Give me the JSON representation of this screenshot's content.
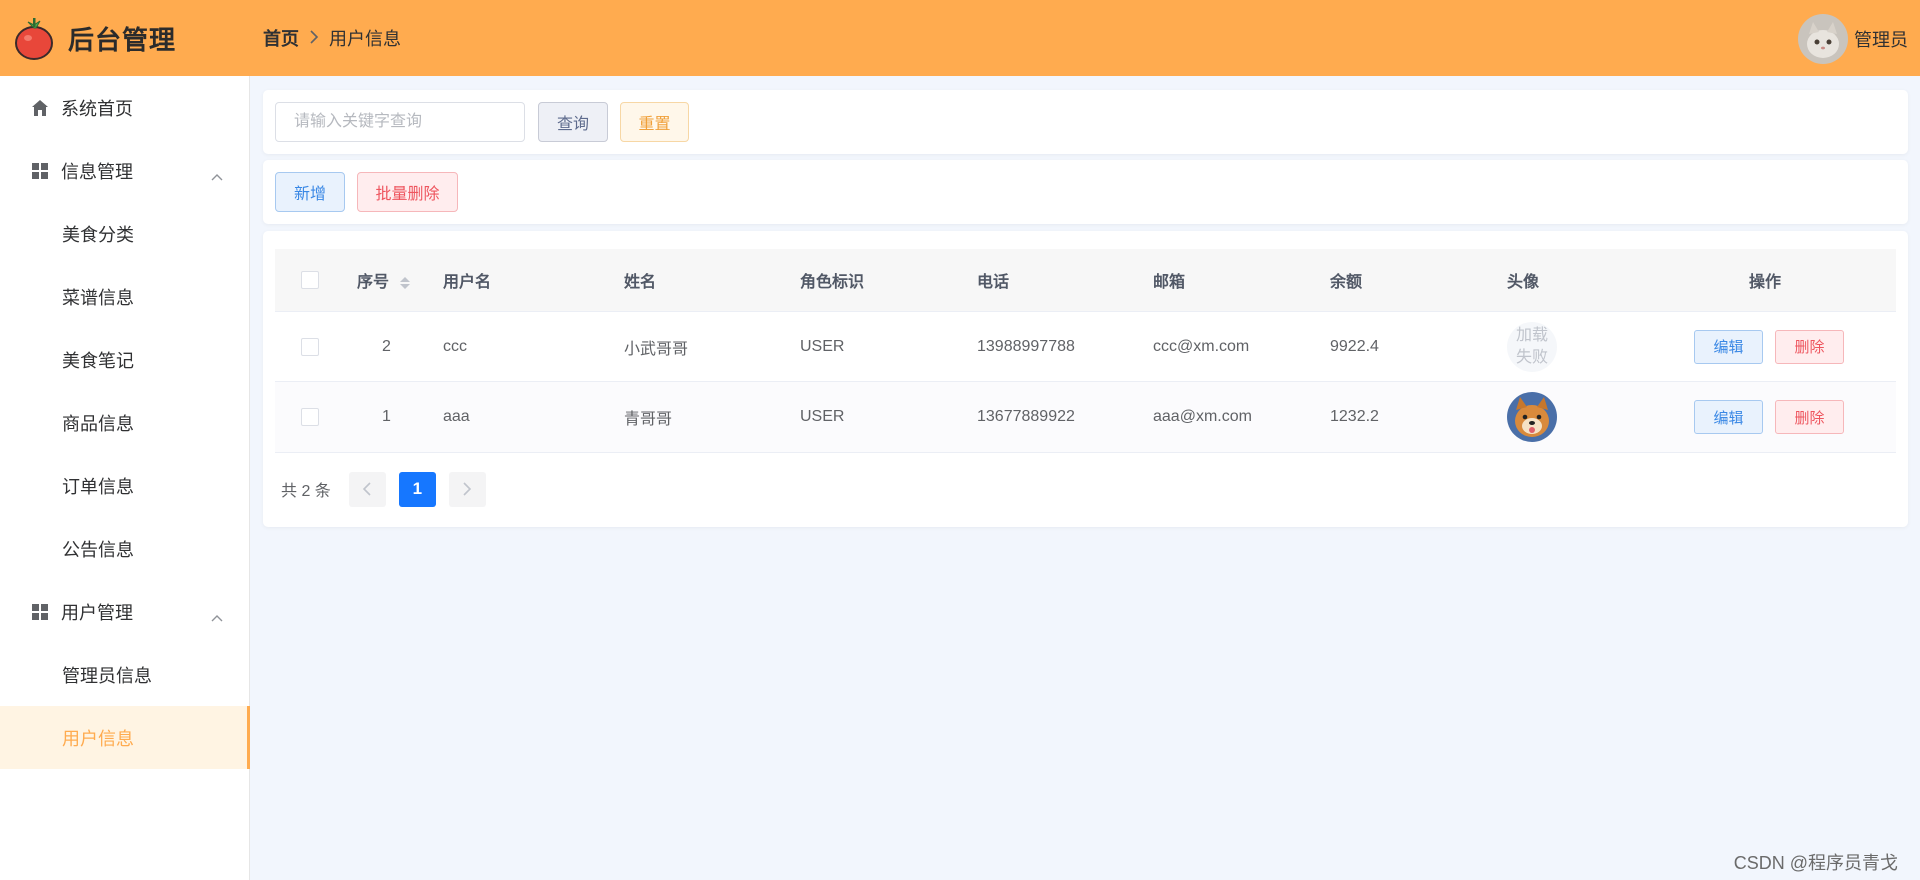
{
  "header": {
    "app_title": "后台管理",
    "breadcrumb_home": "首页",
    "breadcrumb_separator": ">",
    "breadcrumb_current": "用户信息",
    "user_name": "管理员",
    "accent_color": "#ffab4f"
  },
  "sidebar": {
    "items": [
      {
        "label": "系统首页",
        "icon": "home-icon"
      },
      {
        "label": "信息管理",
        "icon": "grid-icon",
        "expanded": true
      },
      {
        "label": "美食分类"
      },
      {
        "label": "菜谱信息"
      },
      {
        "label": "美食笔记"
      },
      {
        "label": "商品信息"
      },
      {
        "label": "订单信息"
      },
      {
        "label": "公告信息"
      },
      {
        "label": "用户管理",
        "icon": "grid-icon",
        "expanded": true
      },
      {
        "label": "管理员信息"
      },
      {
        "label": "用户信息",
        "active": true
      }
    ]
  },
  "search": {
    "placeholder": "请输入关键字查询",
    "query_label": "查询",
    "reset_label": "重置"
  },
  "actions": {
    "add_label": "新增",
    "batch_delete_label": "批量删除"
  },
  "table": {
    "columns": [
      "序号",
      "用户名",
      "姓名",
      "角色标识",
      "电话",
      "邮箱",
      "余额",
      "头像",
      "操作"
    ],
    "rows": [
      {
        "id": "2",
        "username": "ccc",
        "name": "小武哥哥",
        "role": "USER",
        "phone": "13988997788",
        "email": "ccc@xm.com",
        "balance": "9922.4",
        "avatar_failed_text": "加载失败",
        "edit": "编辑",
        "delete": "删除"
      },
      {
        "id": "1",
        "username": "aaa",
        "name": "青哥哥",
        "role": "USER",
        "phone": "13677889922",
        "email": "aaa@xm.com",
        "balance": "1232.2",
        "avatar": "dog-photo",
        "edit": "编辑",
        "delete": "删除"
      }
    ]
  },
  "pagination": {
    "total_text": "共 2 条",
    "current_page": "1"
  },
  "watermark": "CSDN @程序员青戈"
}
